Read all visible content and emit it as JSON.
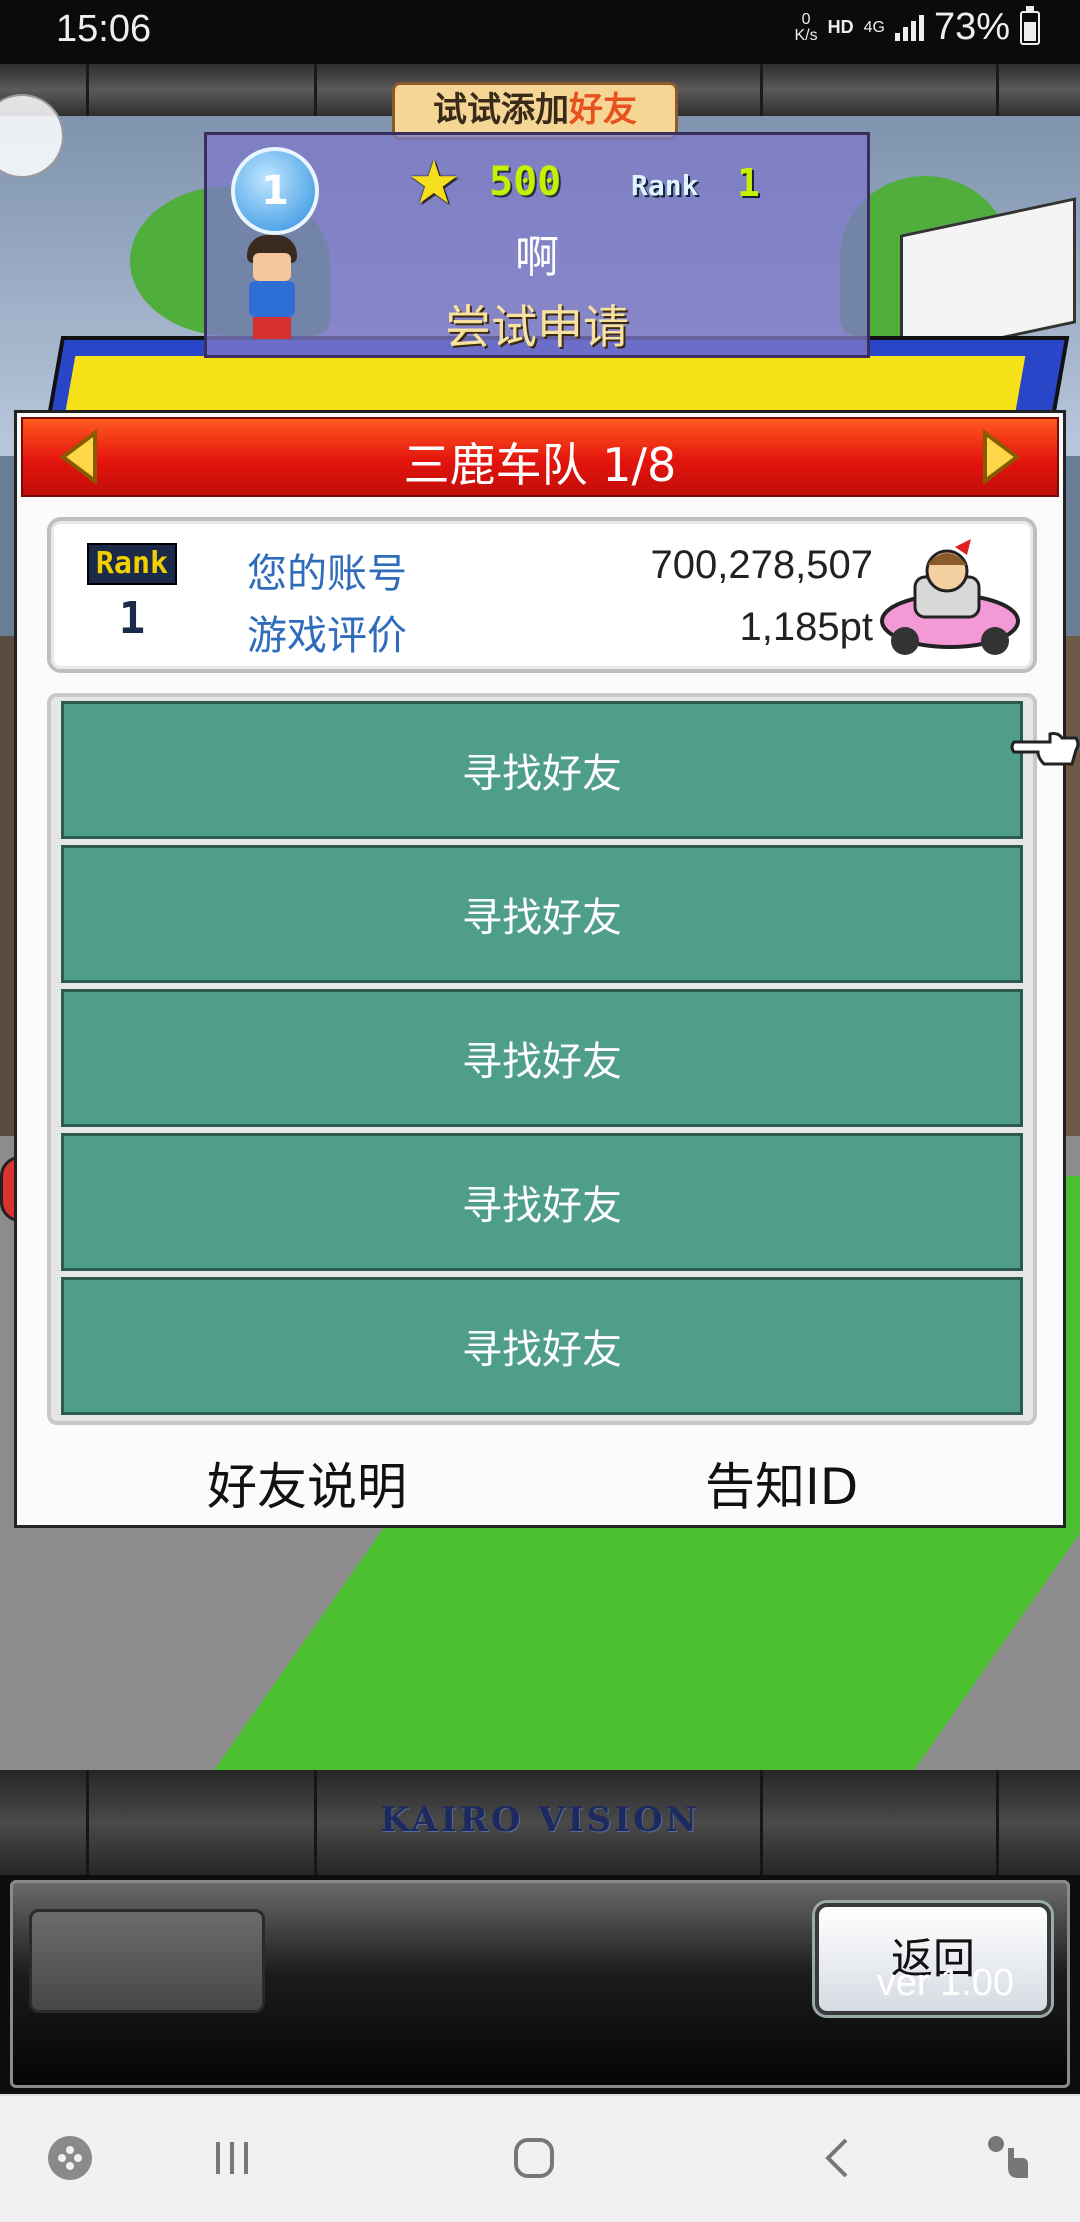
{
  "status_bar": {
    "time": "15:06",
    "net_speed_value": "0",
    "net_speed_unit": "K/s",
    "hd": "HD",
    "network": "4G",
    "battery": "73%",
    "battery_level": 0.73
  },
  "popup": {
    "tag_prefix": "试试添加",
    "tag_highlight": "好友",
    "rank_number": "1",
    "score": "500",
    "rank_label": "Rank",
    "rank_value": "1",
    "name": "啊",
    "action": "尝试申请"
  },
  "panel": {
    "team_title": "三鹿车队 1/8",
    "rank_badge_label": "Rank",
    "rank_badge_value": "1",
    "account_label": "您的账号",
    "account_value": "700,278,507",
    "rating_label": "游戏评价",
    "rating_value": "1,185pt",
    "slots": [
      {
        "label": "寻找好友"
      },
      {
        "label": "寻找好友"
      },
      {
        "label": "寻找好友"
      },
      {
        "label": "寻找好友"
      },
      {
        "label": "寻找好友"
      }
    ],
    "help_link": "好友说明",
    "id_link": "告知ID"
  },
  "footer": {
    "logo": "KAIRO VISION",
    "back_button": "返回",
    "version": "ver 1.00"
  },
  "colors": {
    "header_red": "#e4140e",
    "slot_teal": "#4f9e8a",
    "label_blue": "#2f6cbb"
  },
  "nav_icons": [
    "game-launcher-icon",
    "recents-icon",
    "home-icon",
    "back-icon",
    "accessibility-icon"
  ]
}
